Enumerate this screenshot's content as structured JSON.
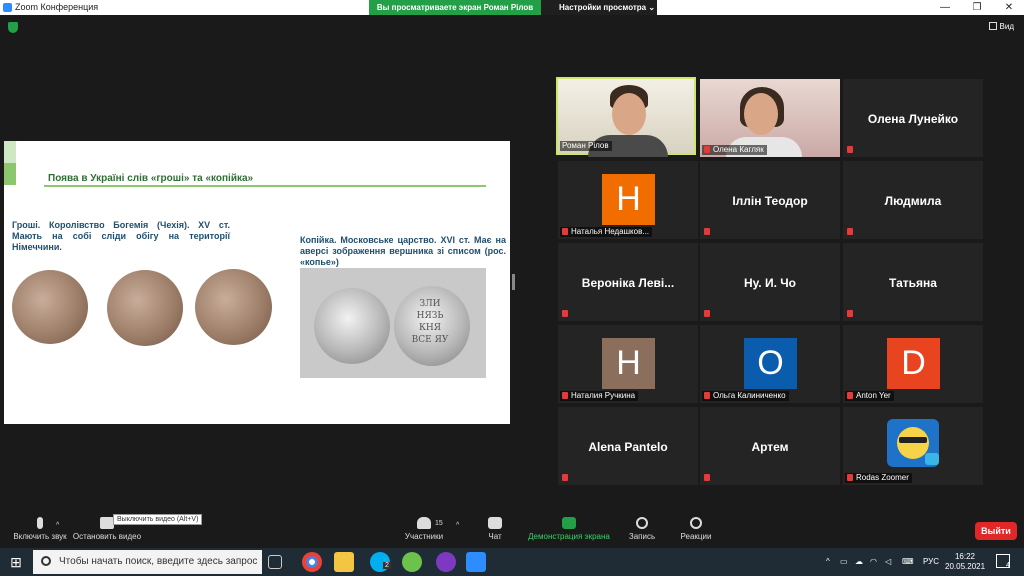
{
  "window": {
    "title": "Zoom Конференция",
    "share_banner": "Вы просматриваете экран Роман Рілов",
    "view_settings": "Настройки просмотра ⌄",
    "minimize": "—",
    "maximize": "❐",
    "close": "✕"
  },
  "topbar": {
    "view_label": "Вид"
  },
  "slide": {
    "title": "Поява в Україні слів «гроші» та «копійка»",
    "left_text": "Гроші. Королівство Богемія (Чехія). XV ст. Мають на собі сліди обігу на території Німеччини.",
    "right_text": "Копійка. Московське царство. XVI ст. Має на аверсі зображення вершника зі списом (рос. «копье»)",
    "coin_inscription": "ЗЛИ НЯЗЬ КНЯ ВСЕ ЯУ"
  },
  "participants": [
    {
      "name": "Роман Рілов",
      "type": "video",
      "active": true
    },
    {
      "name": "Олена Кагляк",
      "type": "video",
      "active": false
    },
    {
      "name": "Олена Лунейко",
      "type": "name"
    },
    {
      "name": "Наталья Недашковская",
      "type": "avatar",
      "letter": "H",
      "label": "Наталья Недашков...",
      "color": "#f26d00"
    },
    {
      "name": "Іллін Теодор",
      "type": "name"
    },
    {
      "name": "Людмила",
      "type": "name"
    },
    {
      "name": "Вероніка Леві...",
      "type": "name"
    },
    {
      "name": "Ну. И. Чо",
      "type": "name"
    },
    {
      "name": "Татьяна",
      "type": "name"
    },
    {
      "name": "Наталия Ручкина",
      "type": "avatar",
      "letter": "H",
      "color": "#8c6e5d"
    },
    {
      "name": "Ольга Калиниченко",
      "type": "avatar",
      "letter": "O",
      "color": "#0b5cad"
    },
    {
      "name": "Anton Yer",
      "type": "avatar",
      "letter": "D",
      "color": "#e8441f"
    },
    {
      "name": "Alena Pantelo",
      "type": "name"
    },
    {
      "name": "Артем",
      "type": "name"
    },
    {
      "name": "Rodas Zoomer",
      "type": "emoji"
    }
  ],
  "toolbar": {
    "unmute": "Включить звук",
    "stop_video": "Остановить видео",
    "tooltip": "Выключить видео (Alt+V)",
    "participants": "Участники",
    "participants_count": "15",
    "chat": "Чат",
    "share": "Демонстрация экрана",
    "record": "Запись",
    "reactions": "Реакции",
    "leave": "Выйти"
  },
  "taskbar": {
    "search_placeholder": "Чтобы начать поиск, введите здесь запрос",
    "lang": "РУС",
    "time": "16:22",
    "date": "20.05.2021",
    "notif_count": "4",
    "skype_badge": "2"
  },
  "colors": {
    "share_green": "#23a047",
    "leave_red": "#e02828",
    "active_border": "#cde66a"
  }
}
